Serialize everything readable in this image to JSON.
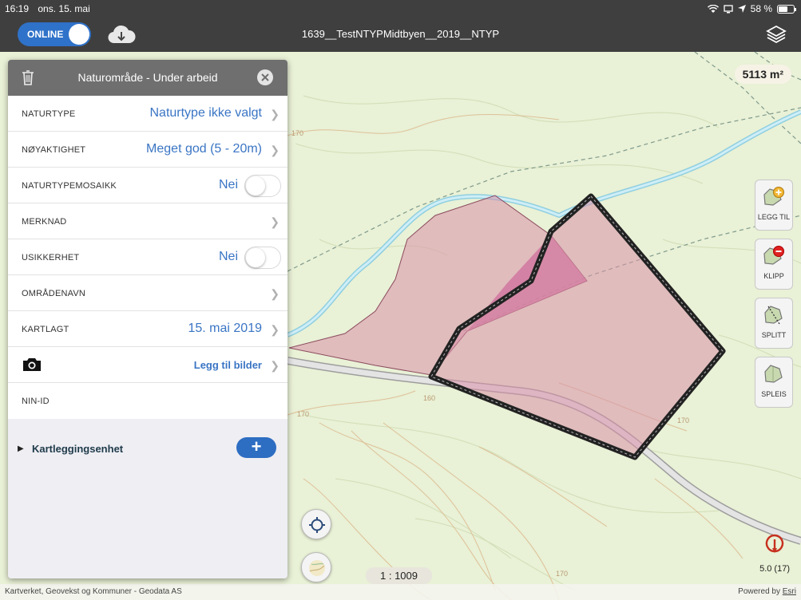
{
  "status": {
    "time": "16:19",
    "date": "ons. 15. mai",
    "battery": "58 %"
  },
  "toolbar": {
    "online_label": "ONLINE",
    "map_title": "1639__TestNTYPMidtbyen__2019__NTYP"
  },
  "map": {
    "area": "5113 m²",
    "scale": "1 : 1009",
    "gps_accuracy": "5.0 (17)",
    "attribution": "Kartverket, Geovekst og Kommuner - Geodata AS",
    "powered_by": "Powered by",
    "esri": "Esri",
    "contours": [
      "170",
      "160",
      "170",
      "170",
      "170"
    ]
  },
  "tools": [
    {
      "id": "legg-til",
      "label": "LEGG TIL"
    },
    {
      "id": "klipp",
      "label": "KLIPP"
    },
    {
      "id": "splitt",
      "label": "SPLITT"
    },
    {
      "id": "spleis",
      "label": "SPLEIS"
    }
  ],
  "panel": {
    "title": "Naturområde - Under arbeid",
    "rows": [
      {
        "label": "NATURTYPE",
        "value": "Naturtype ikke valgt"
      },
      {
        "label": "NØYAKTIGHET",
        "value": "Meget god (5 - 20m)"
      },
      {
        "label": "NATURTYPEMOSAIKK",
        "value": "Nei"
      },
      {
        "label": "MERKNAD",
        "value": ""
      },
      {
        "label": "USIKKERHET",
        "value": "Nei"
      },
      {
        "label": "OMRÅDENAVN",
        "value": ""
      },
      {
        "label": "KARTLAGT",
        "value": "15. mai 2019"
      },
      {
        "label": "",
        "value": "Legg til bilder"
      },
      {
        "label": "NIN-ID",
        "value": ""
      }
    ],
    "section": "Kartleggingsenhet",
    "add": "+"
  },
  "colors": {
    "accent": "#2f72c9",
    "polygon_fill": "#d990a8",
    "map_bg": "#e9f1d6",
    "river": "#a9dff0"
  }
}
